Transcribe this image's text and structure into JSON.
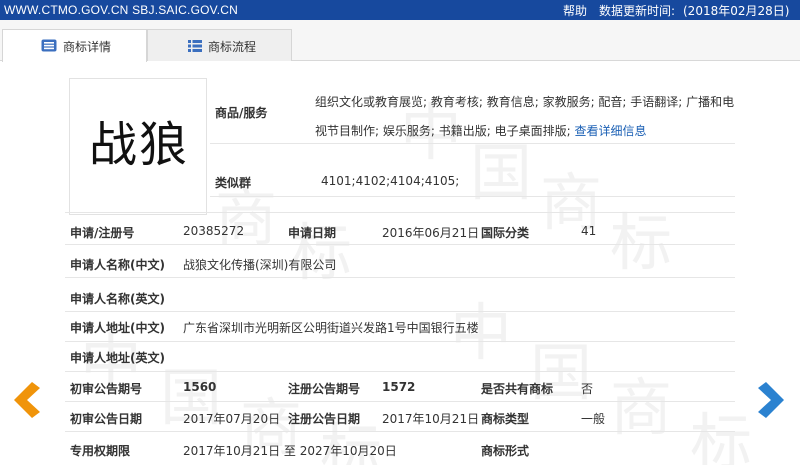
{
  "topbar": {
    "domain": "WWW.CTMO.GOV.CN SBJ.SAIC.GOV.CN",
    "help": "帮助",
    "update_label": "数据更新时间:",
    "update_value": "(2018年02月28日)"
  },
  "tabs": [
    {
      "label": "商标详情",
      "icon": "detail-list-icon",
      "active": true
    },
    {
      "label": "商标流程",
      "icon": "process-list-icon",
      "active": false
    }
  ],
  "watermark": [
    "中",
    "国",
    "商",
    "标",
    "中",
    "国",
    "商",
    "标",
    "中",
    "国",
    "商",
    "标",
    "中",
    "国",
    "商",
    "标"
  ],
  "trademark": {
    "mark_text": "战狼",
    "goods_label": "商品/服务",
    "goods_text": "组织文化或教育展览; 教育考核; 教育信息; 家教服务; 配音; 手语翻译; 广播和电视节目制作; 娱乐服务; 书籍出版; 电子桌面排版;",
    "goods_link": "查看详细信息",
    "similar_label": "类似群",
    "similar_value": "4101;4102;4104;4105;"
  },
  "rows": {
    "reg_no_label": "申请/注册号",
    "reg_no_value": "20385272",
    "apply_date_label": "申请日期",
    "apply_date_value": "2016年06月21日",
    "intl_class_label": "国际分类",
    "intl_class_value": "41",
    "applicant_cn_label": "申请人名称(中文)",
    "applicant_cn_value": "战狼文化传播(深圳)有限公司",
    "applicant_en_label": "申请人名称(英文)",
    "applicant_en_value": "",
    "address_cn_label": "申请人地址(中文)",
    "address_cn_value": "广东省深圳市光明新区公明街道兴发路1号中国银行五楼",
    "address_en_label": "申请人地址(英文)",
    "address_en_value": "",
    "prelim_no_label": "初审公告期号",
    "prelim_no_value": "1560",
    "reg_pub_no_label": "注册公告期号",
    "reg_pub_no_value": "1572",
    "shared_label": "是否共有商标",
    "shared_value": "否",
    "prelim_date_label": "初审公告日期",
    "prelim_date_value": "2017年07月20日",
    "reg_pub_date_label": "注册公告日期",
    "reg_pub_date_value": "2017年10月21日",
    "tm_type_label": "商标类型",
    "tm_type_value": "一般",
    "exclusive_label": "专用权期限",
    "exclusive_value": "2017年10月21日 至 2027年10月20日",
    "tm_form_label": "商标形式",
    "tm_form_value": ""
  },
  "colors": {
    "topbar_bg": "#17499e",
    "arrow_left": "#f0940a",
    "arrow_right": "#2b82d0",
    "link": "#1a5fb4"
  }
}
